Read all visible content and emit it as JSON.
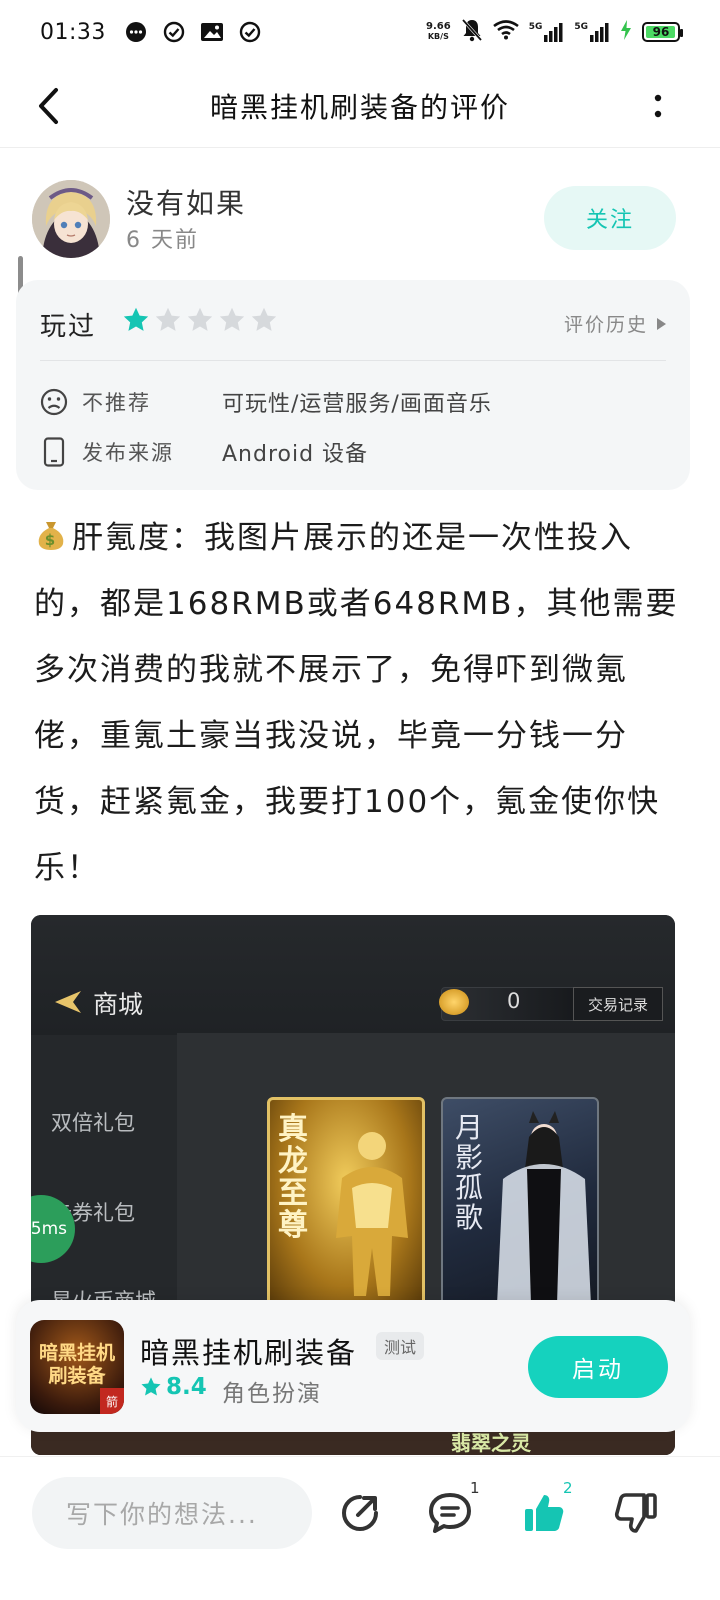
{
  "status_bar": {
    "time": "01:33",
    "net_speed_value": "9.66",
    "net_speed_unit": "KB/S",
    "signal1": "5G",
    "signal2": "5G",
    "battery": "96",
    "battery_level": 0.96
  },
  "header": {
    "title": "暗黑挂机刷装备的评价"
  },
  "user": {
    "name": "没有如果",
    "time": "6 天前",
    "follow_label": "关注"
  },
  "info_card": {
    "played_label": "玩过",
    "rating": 1,
    "rating_max": 5,
    "history_label": "评价历史",
    "recommend_label": "不推荐",
    "recommend_tags": "可玩性/运营服务/画面音乐",
    "source_label": "发布来源",
    "source_value": "Android 设备"
  },
  "review": {
    "text": "肝氪度：我图片展示的还是一次性投入的，都是168RMB或者648RMB，其他需要多次消费的我就不展示了，免得吓到微氪佬，重氪土豪当我没说，毕竟一分钱一分货，赶紧氪金，我要打100个，氪金使你快乐！"
  },
  "screenshot": {
    "title": "商城",
    "coin_value": "0",
    "trade_label": "交易记录",
    "side_items": [
      "双倍礼包",
      "卡券礼包",
      "星火币商城"
    ],
    "card1_text": "真龙至尊",
    "card2_text": "月影孤歌",
    "bottom_text": "翡翠之灵",
    "ms_badge": "5ms"
  },
  "game": {
    "icon_text": "暗黑挂机刷装备",
    "icon_tag": "箭",
    "name": "暗黑挂机刷装备",
    "badge": "测试",
    "rating": "8.4",
    "genre": "角色扮演",
    "start_label": "启动"
  },
  "bottom_bar": {
    "input_placeholder": "写下你的想法...",
    "comment_count": "1",
    "like_count": "2"
  },
  "colors": {
    "accent": "#15c5b3",
    "start_button": "#15d2be",
    "follow_bg": "#e6f8f5",
    "card_bg": "#f4f6f7"
  }
}
